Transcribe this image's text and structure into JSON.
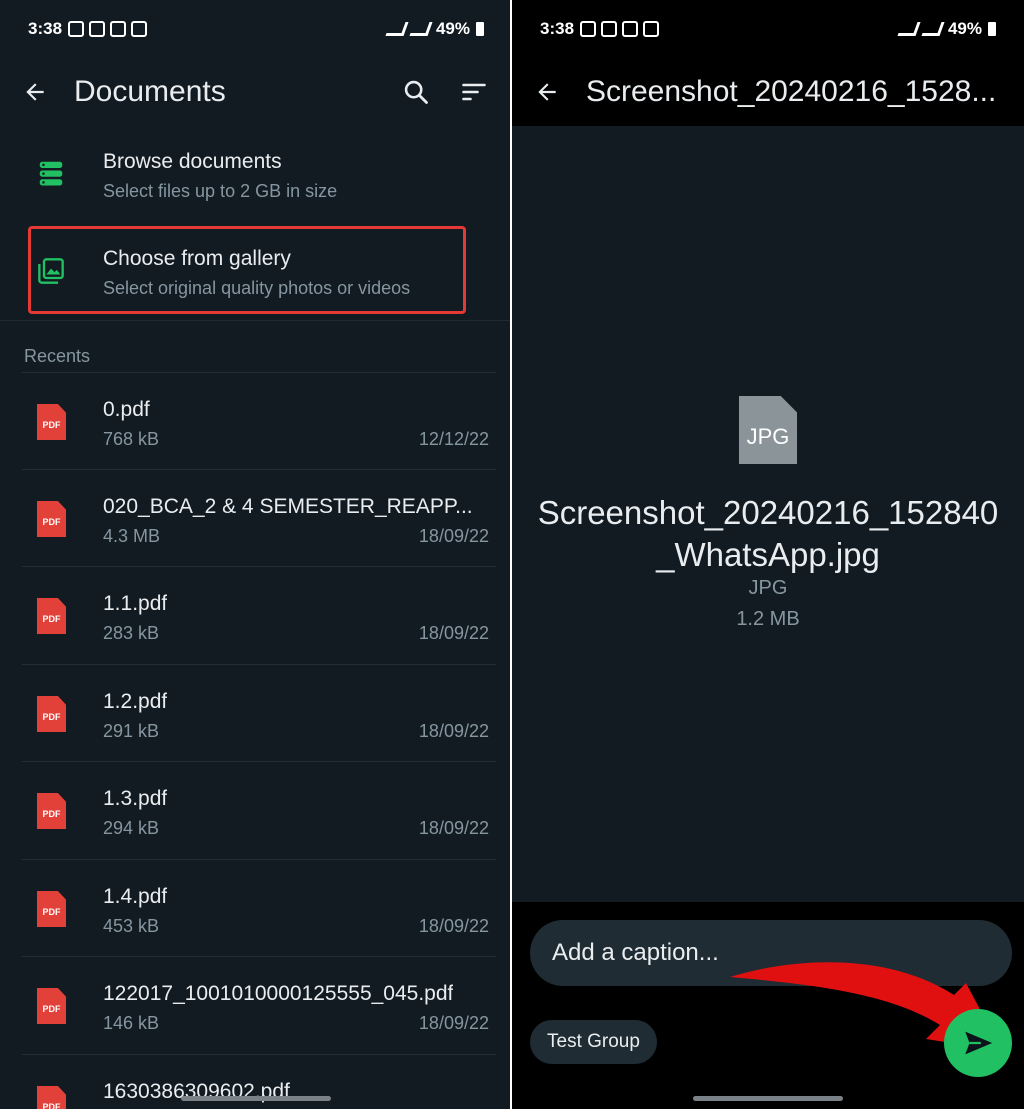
{
  "left": {
    "status": {
      "time": "3:38",
      "battery": "49%"
    },
    "title": "Documents",
    "options": [
      {
        "title": "Browse documents",
        "subtitle": "Select files up to 2 GB in size"
      },
      {
        "title": "Choose from gallery",
        "subtitle": "Select original quality photos or videos"
      }
    ],
    "recents_label": "Recents",
    "files": [
      {
        "name": "0.pdf",
        "size": "768 kB",
        "date": "12/12/22",
        "icon_label": "PDF"
      },
      {
        "name": "020_BCA_2 & 4 SEMESTER_REAPP...",
        "size": "4.3 MB",
        "date": "18/09/22",
        "icon_label": "PDF"
      },
      {
        "name": "1.1.pdf",
        "size": "283 kB",
        "date": "18/09/22",
        "icon_label": "PDF"
      },
      {
        "name": "1.2.pdf",
        "size": "291 kB",
        "date": "18/09/22",
        "icon_label": "PDF"
      },
      {
        "name": "1.3.pdf",
        "size": "294 kB",
        "date": "18/09/22",
        "icon_label": "PDF"
      },
      {
        "name": "1.4.pdf",
        "size": "453 kB",
        "date": "18/09/22",
        "icon_label": "PDF"
      },
      {
        "name": "122017_1001010000125555_045.pdf",
        "size": "146 kB",
        "date": "18/09/22",
        "icon_label": "PDF"
      },
      {
        "name": "1630386309602.pdf",
        "size": "",
        "date": "",
        "icon_label": "PDF"
      }
    ]
  },
  "right": {
    "status": {
      "time": "3:38",
      "battery": "49%"
    },
    "title": "Screenshot_20240216_1528...",
    "doc": {
      "icon_label": "JPG",
      "name": "Screenshot_20240216_152840_WhatsApp.jpg",
      "type": "JPG",
      "size": "1.2 MB"
    },
    "caption_placeholder": "Add a caption...",
    "recipient": "Test Group"
  },
  "colors": {
    "accent_green": "#21c063",
    "highlight_red": "#e53935",
    "background": "#121b22"
  }
}
